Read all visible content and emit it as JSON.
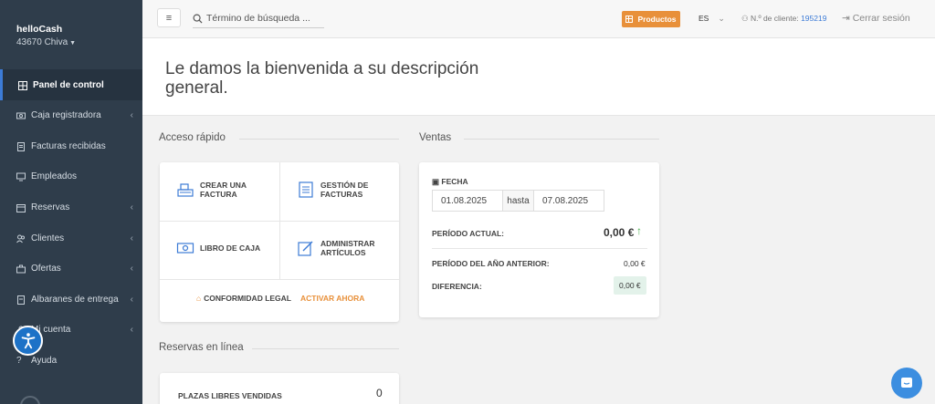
{
  "sidebar": {
    "brand_name": "helloCash",
    "brand_location": "43670 Chiva",
    "items": [
      {
        "label": "Panel de control"
      },
      {
        "label": "Caja registradora"
      },
      {
        "label": "Facturas recibidas"
      },
      {
        "label": "Empleados"
      },
      {
        "label": "Reservas"
      },
      {
        "label": "Clientes"
      },
      {
        "label": "Ofertas"
      },
      {
        "label": "Albaranes de entrega"
      },
      {
        "label": "Mi cuenta"
      },
      {
        "label": "Ayuda"
      }
    ]
  },
  "topbar": {
    "search_placeholder": "Término de búsqueda ...",
    "products_label": "Productos",
    "language": "ES",
    "client_label": "N.º de cliente:",
    "client_number": "195219",
    "logout_label": "Cerrar sesión"
  },
  "welcome": {
    "title": "Le damos la bienvenida a su descripción general."
  },
  "quick_access": {
    "title": "Acceso rápido",
    "create_invoice": "CREAR UNA FACTURA",
    "manage_invoices": "GESTIÓN DE FACTURAS",
    "cash_book": "LIBRO DE CAJA",
    "manage_items": "ADMINISTRAR ARTÍCULOS",
    "legal_label": "CONFORMIDAD LEGAL",
    "legal_action": "ACTIVAR AHORA"
  },
  "sales": {
    "title": "Ventas",
    "date_label": "FECHA",
    "date_from": "01.08.2025",
    "date_sep": "hasta",
    "date_to": "07.08.2025",
    "current_period_label": "PERÍODO ACTUAL:",
    "current_period_value": "0,00 €",
    "prev_year_label": "PERÍODO DEL AÑO ANTERIOR:",
    "prev_year_value": "0,00 €",
    "difference_label": "DIFERENCIA:",
    "difference_value": "0,00 €"
  },
  "online_bookings": {
    "title": "Reservas en línea",
    "sold_label": "PLAZAS LIBRES VENDIDAS",
    "sold_value": "0"
  },
  "colors": {
    "sidebar": "#2f3d4b",
    "accent_orange": "#e8903a",
    "accent_blue": "#3c7bd6",
    "positive_green": "#4caf50"
  }
}
